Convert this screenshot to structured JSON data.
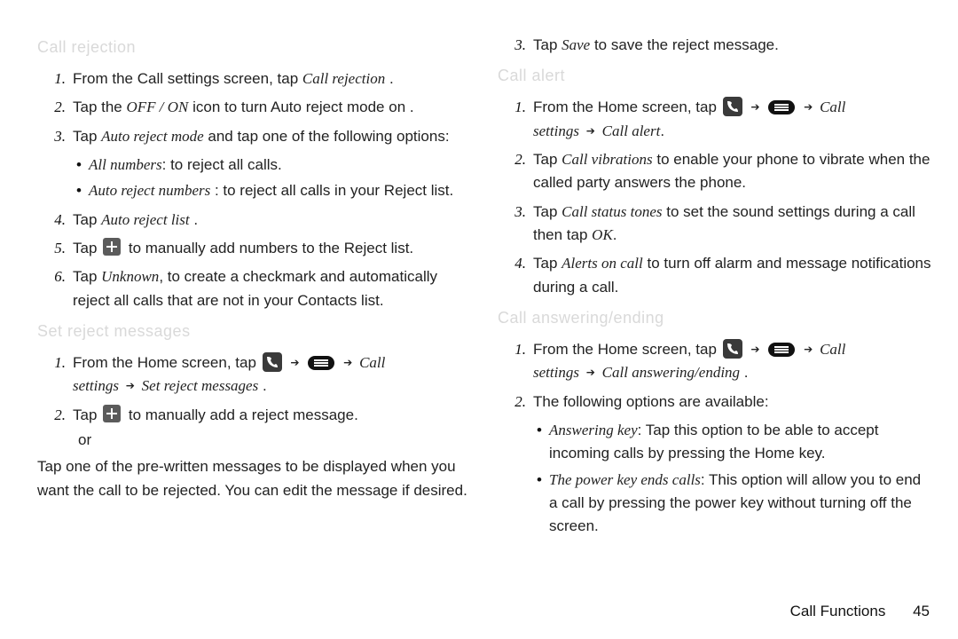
{
  "footer": {
    "section": "Call Functions",
    "page": "45"
  },
  "icons": {
    "phone": "phone-icon",
    "menu": "menu-icon",
    "plus": "plus-icon"
  },
  "nav": {
    "arrow": "➔"
  },
  "left": {
    "h_call_rejection": "Call rejection",
    "s1": {
      "pre": "From the Call settings screen, tap ",
      "em": "Call rejection",
      "post": " ."
    },
    "s2": {
      "pre": "Tap the ",
      "em": "OFF / ON",
      "post": "  icon to turn Auto reject mode on ."
    },
    "s3": {
      "pre": "Tap ",
      "em": "Auto reject mode",
      "post": "   and tap one of the following options:"
    },
    "s3a": {
      "em": "All numbers",
      "txt": ": to reject all calls."
    },
    "s3b": {
      "em": "Auto reject numbers",
      "txt": "  : to reject all calls in your Reject list."
    },
    "s4": {
      "pre": "Tap ",
      "em": "Auto reject list",
      "post": "  ."
    },
    "s5": {
      "pre": "Tap ",
      "post": "  to manually add numbers to the Reject list."
    },
    "s6": {
      "pre": "Tap ",
      "em": "Unknown",
      "post": ", to create a checkmark and automatically reject all calls that are not in your Contacts list."
    },
    "h_set_reject": "Set reject messages",
    "r1": {
      "pre": "From the Home screen, tap ",
      "call": "Call",
      "settings": "settings",
      "set_reject": "Set reject messages",
      "dot": " ."
    },
    "r2": {
      "pre": "Tap ",
      "post": "  to manually add a reject message.",
      "or": "or",
      "para": "Tap one of the pre-written messages to be displayed when you want the call to be rejected. You can edit the message if desired."
    }
  },
  "right": {
    "top3": {
      "pre": "Tap ",
      "em": "Save",
      "post": " to save the reject message."
    },
    "h_call_alert": "Call alert",
    "a1": {
      "pre": "From the Home screen, tap ",
      "call": "Call",
      "settings": "settings",
      "call_alert": "Call alert",
      "dot": "."
    },
    "a2": {
      "pre": "Tap ",
      "em": "Call vibrations",
      "post": "  to enable your phone to vibrate when the called party answers the phone."
    },
    "a3": {
      "pre": "Tap ",
      "em": "Call status tones",
      "post": "  to set the sound settings during a call then tap ",
      "em2": "OK",
      "post2": "."
    },
    "a4": {
      "pre": "Tap ",
      "em": "Alerts on call",
      "post": "  to turn off alarm and message notifications during a call."
    },
    "h_call_ans": "Call answering/ending",
    "e1": {
      "pre": "From the Home screen, tap ",
      "call": "Call",
      "settings": "settings",
      "ansend": "Call answering/ending",
      "dot": "  ."
    },
    "e2": {
      "txt": "The following options are available:"
    },
    "e2a": {
      "em": "Answering key",
      "txt": ": Tap this option to be able to accept incoming calls by pressing the Home key."
    },
    "e2b": {
      "em": "The power key ends calls",
      "txt": ": This option will allow you to end a call by pressing the power key without turning off the screen."
    }
  }
}
